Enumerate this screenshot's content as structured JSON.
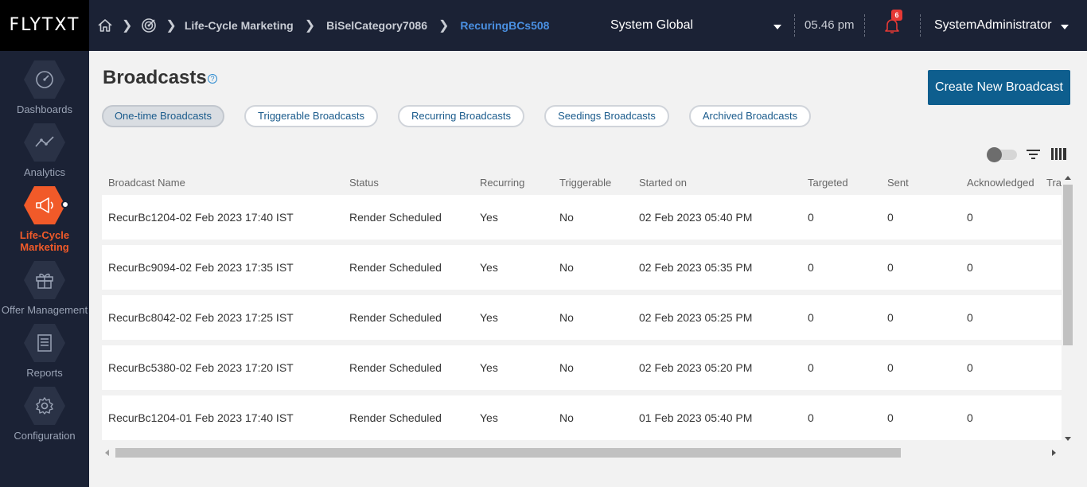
{
  "app": {
    "logo": "FLYTXT"
  },
  "breadcrumb": {
    "items": [
      "Life-Cycle Marketing",
      "BiSelCategory7086",
      "RecuringBCs508"
    ]
  },
  "header": {
    "region": "System Global",
    "time": "05.46 pm",
    "notifications": "6",
    "user": "SystemAdministrator"
  },
  "sidebar": {
    "items": [
      {
        "label": "Dashboards",
        "icon": "gauge-icon"
      },
      {
        "label": "Analytics",
        "icon": "line-chart-icon"
      },
      {
        "label": "Life-Cycle Marketing",
        "icon": "megaphone-icon",
        "active": true
      },
      {
        "label": "Offer Management",
        "icon": "gift-icon"
      },
      {
        "label": "Reports",
        "icon": "document-icon"
      },
      {
        "label": "Configuration",
        "icon": "gear-icon"
      }
    ]
  },
  "page": {
    "title": "Broadcasts",
    "help": "?",
    "create_button": "Create New Broadcast"
  },
  "tabs": [
    "One-time Broadcasts",
    "Triggerable Broadcasts",
    "Recurring Broadcasts",
    "Seedings Broadcasts",
    "Archived Broadcasts"
  ],
  "table": {
    "columns": [
      "Broadcast Name",
      "Status",
      "Recurring",
      "Triggerable",
      "Started on",
      "Targeted",
      "Sent",
      "Acknowledged",
      "Tra"
    ],
    "rows": [
      [
        "RecurBc1204-02 Feb 2023 17:40 IST",
        "Render Scheduled",
        "Yes",
        "No",
        "02 Feb 2023 05:40 PM",
        "0",
        "0",
        "0"
      ],
      [
        "RecurBc9094-02 Feb 2023 17:35 IST",
        "Render Scheduled",
        "Yes",
        "No",
        "02 Feb 2023 05:35 PM",
        "0",
        "0",
        "0"
      ],
      [
        "RecurBc8042-02 Feb 2023 17:25 IST",
        "Render Scheduled",
        "Yes",
        "No",
        "02 Feb 2023 05:25 PM",
        "0",
        "0",
        "0"
      ],
      [
        "RecurBc5380-02 Feb 2023 17:20 IST",
        "Render Scheduled",
        "Yes",
        "No",
        "02 Feb 2023 05:20 PM",
        "0",
        "0",
        "0"
      ],
      [
        "RecurBc1204-01 Feb 2023 17:40 IST",
        "Render Scheduled",
        "Yes",
        "No",
        "01 Feb 2023 05:40 PM",
        "0",
        "0",
        "0"
      ]
    ]
  },
  "colors": {
    "accent": "#f15a29",
    "primary_button": "#0e5e8e",
    "link": "#4a90e2",
    "topbar": "#1b2235"
  }
}
